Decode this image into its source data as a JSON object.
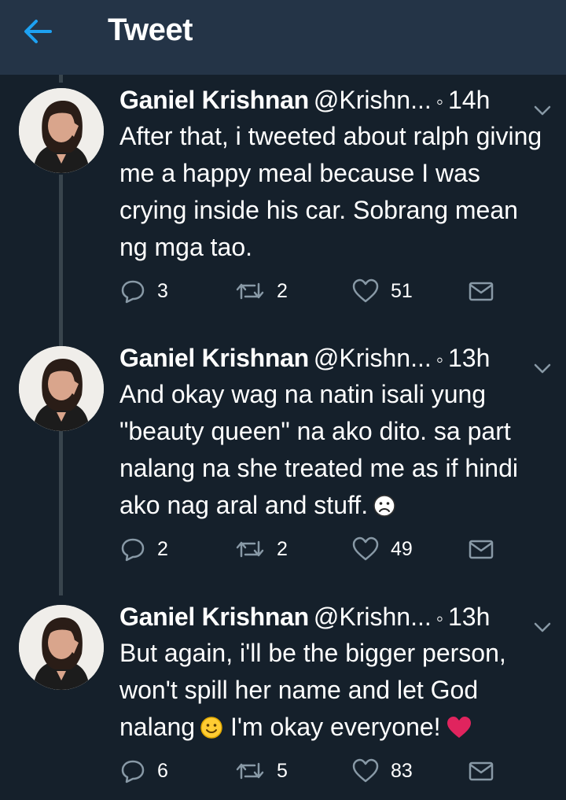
{
  "header": {
    "title": "Tweet",
    "back_icon": "arrow-left-icon",
    "accent": "#1da1f2"
  },
  "colors": {
    "background": "#15202b",
    "header_bg": "#243447",
    "thread_line": "#38444d"
  },
  "tweets": [
    {
      "name": "Ganiel Krishnan",
      "handle": "@Krishn...",
      "time": "14h",
      "text": "After that, i tweeted about ralph giving me a happy meal because I was crying inside his car. Sobrang mean ng mga tao.",
      "replies": "3",
      "retweets": "2",
      "likes": "51"
    },
    {
      "name": "Ganiel Krishnan",
      "handle": "@Krishn...",
      "time": "13h",
      "text": "And okay wag na natin isali yung \"beauty queen\" na ako dito. sa part nalang na she treated me as if hindi ako nag aral and stuff.",
      "emoji": "frowning-face",
      "replies": "2",
      "retweets": "2",
      "likes": "49"
    },
    {
      "name": "Ganiel Krishnan",
      "handle": "@Krishn...",
      "time": "13h",
      "text_a": "But again, i'll be the bigger person, won't spill her name and let God nalang",
      "emoji_a": "smiling-face",
      "text_b": "I'm okay everyone!",
      "emoji_b": "red-heart",
      "replies": "6",
      "retweets": "5",
      "likes": "83"
    }
  ]
}
